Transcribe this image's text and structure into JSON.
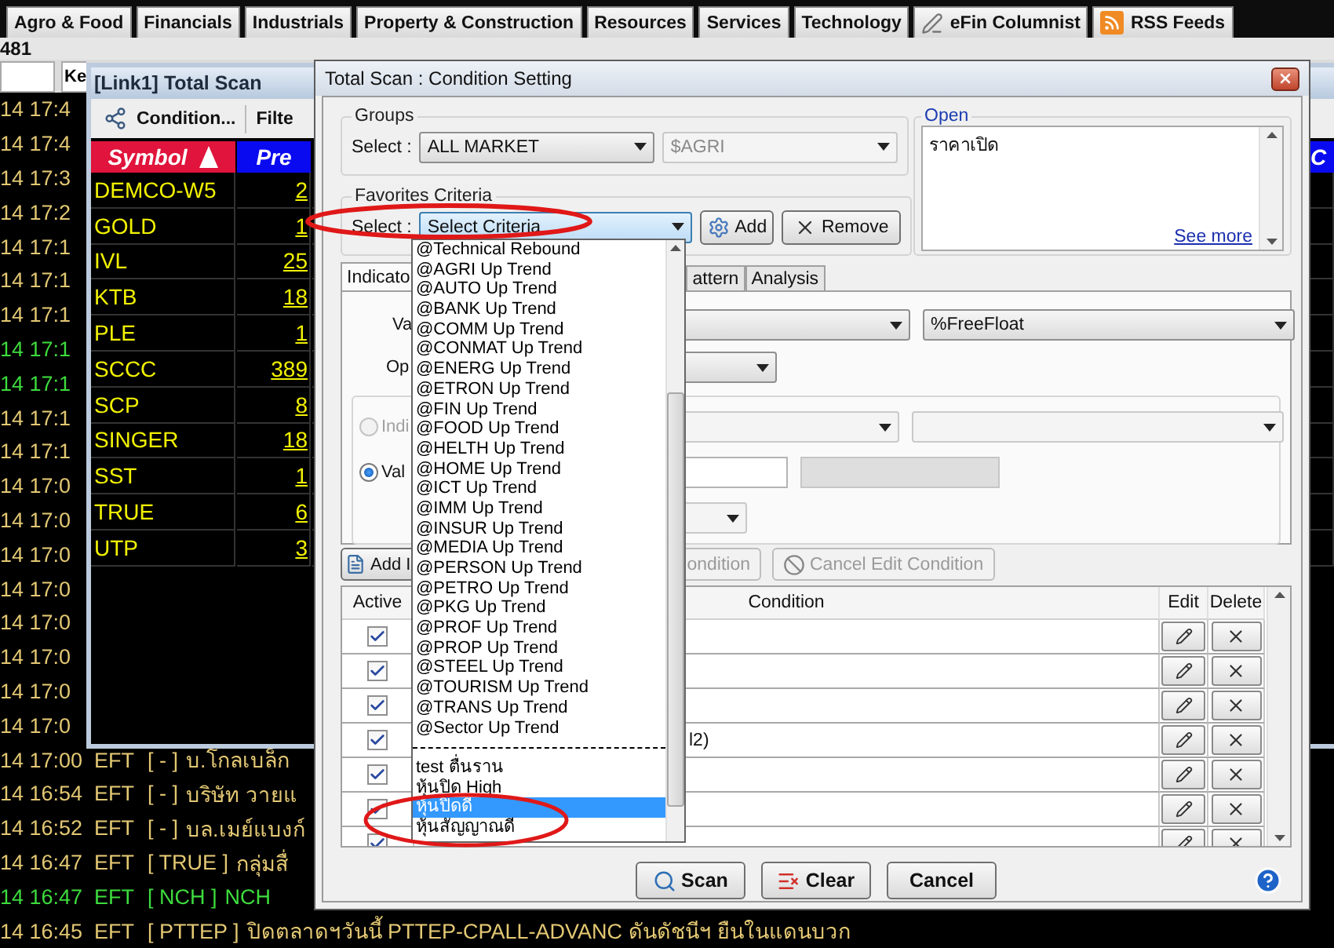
{
  "top_tabs": [
    {
      "label": "Agro & Food",
      "kind": "plain"
    },
    {
      "label": "Financials",
      "kind": "plain"
    },
    {
      "label": "Industrials",
      "kind": "plain"
    },
    {
      "label": "Property & Construction",
      "kind": "plain"
    },
    {
      "label": "Resources",
      "kind": "plain"
    },
    {
      "label": "Services",
      "kind": "plain"
    },
    {
      "label": "Technology",
      "kind": "plain"
    },
    {
      "label": "eFin Columnist",
      "kind": "pen"
    },
    {
      "label": "RSS Feeds",
      "kind": "rss"
    }
  ],
  "header_strip": {
    "account": "481",
    "field_text": "Ke"
  },
  "news": [
    {
      "time": "14 17:4",
      "color": "#e3c873"
    },
    {
      "time": "14 17:4",
      "color": "#e3c873"
    },
    {
      "time": "14 17:3",
      "color": "#e3c873"
    },
    {
      "time": "14 17:2",
      "color": "#e3c873"
    },
    {
      "time": "14 17:1",
      "color": "#e3c873"
    },
    {
      "time": "14 17:1",
      "color": "#e3c873"
    },
    {
      "time": "14 17:1",
      "color": "#e3c873"
    },
    {
      "time": "14 17:1",
      "color": "#3ddc3d"
    },
    {
      "time": "14 17:1",
      "color": "#3ddc3d"
    },
    {
      "time": "14 17:1",
      "color": "#e3c873"
    },
    {
      "time": "14 17:1",
      "color": "#e3c873"
    },
    {
      "time": "14 17:0",
      "color": "#e3c873"
    },
    {
      "time": "14 17:0",
      "color": "#e3c873"
    },
    {
      "time": "14 17:0",
      "color": "#e3c873"
    },
    {
      "time": "14 17:0",
      "color": "#e3c873"
    },
    {
      "time": "14 17:0",
      "color": "#e3c873"
    },
    {
      "time": "14 17:0",
      "color": "#e3c873"
    },
    {
      "time": "14 17:0",
      "color": "#e3c873"
    },
    {
      "time": "14 17:0",
      "color": "#e3c873"
    },
    {
      "time": "14 17:00",
      "source": "EFT",
      "tag": "[ - ]",
      "headline": "บ.โกลเบล็ก",
      "color": "#e3c873"
    },
    {
      "time": "14 16:54",
      "source": "EFT",
      "tag": "[ - ]",
      "headline": "บริษัท วายแ",
      "color": "#e3c873"
    },
    {
      "time": "14 16:52",
      "source": "EFT",
      "tag": "[ - ]",
      "headline": "บล.เมย์แบงก์",
      "color": "#e3c873"
    },
    {
      "time": "14 16:47",
      "source": "EFT",
      "tag": "[ TRUE ]",
      "headline": "กลุ่มสื่",
      "color": "#e3c873"
    },
    {
      "time": "14 16:47",
      "source": "EFT",
      "tag": "[ NCH ]",
      "headline": "NCH",
      "color": "#3ddc3d"
    },
    {
      "time": "14 16:45",
      "source": "EFT",
      "tag": "[ PTTEP ]",
      "headline": "ปิดตลาดฯวันนี้ PTTEP-CPALL-ADVANC ดันดัชนีฯ ยืนในแดนบวก",
      "color": "#e3c873"
    }
  ],
  "scan_window": {
    "title": "[Link1] Total Scan",
    "toolbar": [
      "Condition...",
      "Filte"
    ],
    "columns": [
      {
        "label": "Symbol",
        "sorted": true,
        "color": "#e0143c"
      },
      {
        "label": "Pre",
        "sorted": false,
        "color": "#0a0af0"
      },
      {
        "label": "C",
        "sorted": false,
        "color": "#0a0af0"
      }
    ],
    "rows": [
      {
        "symbol": "DEMCO-W5",
        "value": "2"
      },
      {
        "symbol": "GOLD",
        "value": "1"
      },
      {
        "symbol": "IVL",
        "value": "25"
      },
      {
        "symbol": "KTB",
        "value": "18"
      },
      {
        "symbol": "PLE",
        "value": "1"
      },
      {
        "symbol": "SCCC",
        "value": "389"
      },
      {
        "symbol": "SCP",
        "value": "8"
      },
      {
        "symbol": "SINGER",
        "value": "18"
      },
      {
        "symbol": "SST",
        "value": "1"
      },
      {
        "symbol": "TRUE",
        "value": "6"
      },
      {
        "symbol": "UTP",
        "value": "3"
      }
    ]
  },
  "dialog": {
    "title": "Total Scan : Condition Setting",
    "groups": {
      "legend": "Groups",
      "select_label": "Select :",
      "market": "ALL MARKET",
      "sector": "$AGRI",
      "sector_disabled": true
    },
    "open": {
      "legend": "Open",
      "text": "ราคาเปิด",
      "link": "See more"
    },
    "favorites": {
      "legend": "Favorites Criteria",
      "select_label": "Select :",
      "value": "Select Criteria",
      "add": "Add",
      "remove": "Remove"
    },
    "tabs": [
      {
        "label": "Indicato",
        "selected": true
      },
      {
        "label": "attern",
        "selected": false
      },
      {
        "label": "Analysis",
        "selected": false
      }
    ],
    "panel": {
      "value_label": "Va",
      "value_field": "%FreeFloat",
      "operator_label": "Op",
      "options": [
        {
          "label": "Indi",
          "selected": false,
          "disabled": true
        },
        {
          "label": "Val",
          "selected": true,
          "disabled": false
        }
      ]
    },
    "action_buttons": [
      {
        "label": "Add I",
        "disabled": false,
        "kind": "document"
      },
      {
        "label": "ondition",
        "disabled": true,
        "kind": "plain"
      },
      {
        "label": "Cancel Edit Condition",
        "disabled": true,
        "kind": "cancel"
      }
    ],
    "table": {
      "columns": [
        "Active",
        "Condition",
        "Edit",
        "Delete"
      ],
      "rows": [
        {
          "active": true
        },
        {
          "active": true
        },
        {
          "active": true
        },
        {
          "active": true,
          "condition": "l2)"
        },
        {
          "active": true
        },
        {
          "active": true
        },
        {
          "active": true
        }
      ]
    },
    "buttons": [
      {
        "label": "Scan",
        "kind": "search"
      },
      {
        "label": "Clear",
        "kind": "clear"
      },
      {
        "label": "Cancel",
        "kind": "plain"
      }
    ],
    "criteria_dropdown": {
      "items": [
        {
          "kind": "item",
          "label": "@Technical Rebound",
          "selected": false
        },
        {
          "kind": "item",
          "label": "@AGRI Up Trend",
          "selected": false
        },
        {
          "kind": "item",
          "label": "@AUTO Up Trend",
          "selected": false
        },
        {
          "kind": "item",
          "label": "@BANK Up Trend",
          "selected": false
        },
        {
          "kind": "item",
          "label": "@COMM Up Trend",
          "selected": false
        },
        {
          "kind": "item",
          "label": "@CONMAT Up Trend",
          "selected": false
        },
        {
          "kind": "item",
          "label": "@ENERG Up Trend",
          "selected": false
        },
        {
          "kind": "item",
          "label": "@ETRON Up Trend",
          "selected": false
        },
        {
          "kind": "item",
          "label": "@FIN Up Trend",
          "selected": false
        },
        {
          "kind": "item",
          "label": "@FOOD Up Trend",
          "selected": false
        },
        {
          "kind": "item",
          "label": "@HELTH Up Trend",
          "selected": false
        },
        {
          "kind": "item",
          "label": "@HOME Up Trend",
          "selected": false
        },
        {
          "kind": "item",
          "label": "@ICT Up Trend",
          "selected": false
        },
        {
          "kind": "item",
          "label": "@IMM Up Trend",
          "selected": false
        },
        {
          "kind": "item",
          "label": "@INSUR Up Trend",
          "selected": false
        },
        {
          "kind": "item",
          "label": "@MEDIA Up Trend",
          "selected": false
        },
        {
          "kind": "item",
          "label": "@PERSON Up Trend",
          "selected": false
        },
        {
          "kind": "item",
          "label": "@PETRO Up Trend",
          "selected": false
        },
        {
          "kind": "item",
          "label": "@PKG Up Trend",
          "selected": false
        },
        {
          "kind": "item",
          "label": "@PROF Up Trend",
          "selected": false
        },
        {
          "kind": "item",
          "label": "@PROP Up Trend",
          "selected": false
        },
        {
          "kind": "item",
          "label": "@STEEL Up Trend",
          "selected": false
        },
        {
          "kind": "item",
          "label": "@TOURISM Up Trend",
          "selected": false
        },
        {
          "kind": "item",
          "label": "@TRANS Up Trend",
          "selected": false
        },
        {
          "kind": "item",
          "label": "@Sector Up Trend",
          "selected": false
        },
        {
          "kind": "separator"
        },
        {
          "kind": "item",
          "label": "test ตื่นราน",
          "selected": false
        },
        {
          "kind": "item",
          "label": "หุ้นปิด High",
          "selected": false
        },
        {
          "kind": "item",
          "label": "หุ้นปิดดี",
          "selected": true
        },
        {
          "kind": "item",
          "label": "หุ้นสัญญาณดี",
          "selected": false
        }
      ]
    }
  }
}
